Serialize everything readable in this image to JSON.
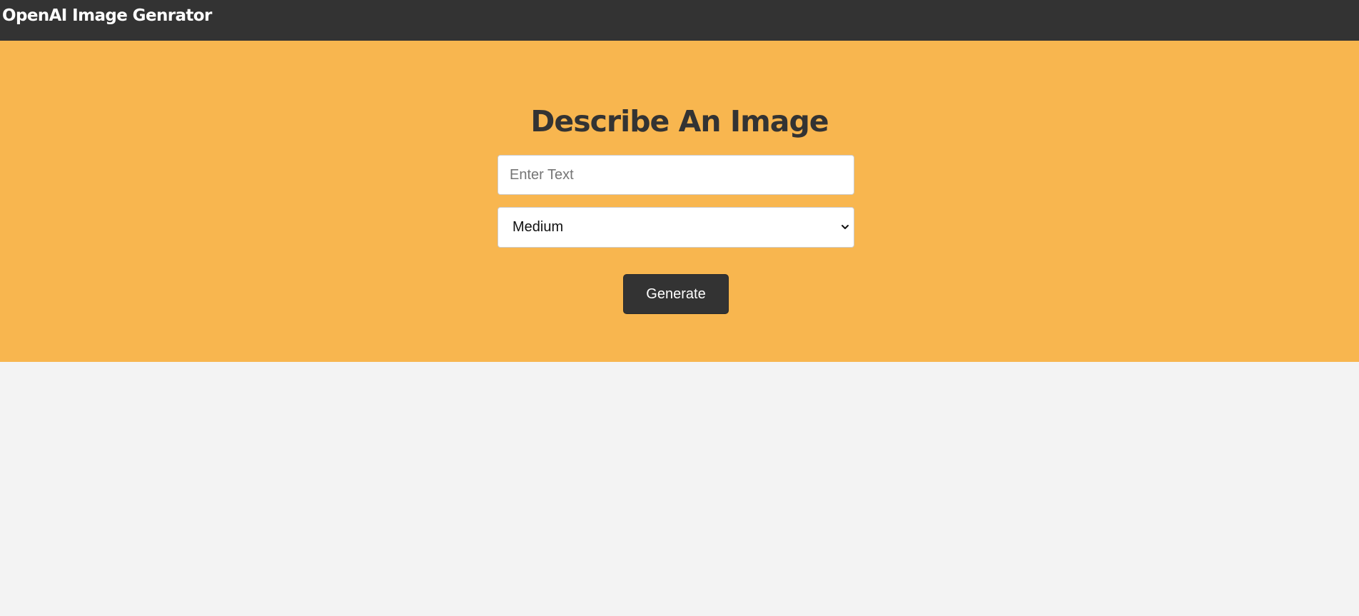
{
  "navbar": {
    "logo_text": "OpenAI Image Genrator"
  },
  "showcase": {
    "heading": "Describe An Image",
    "prompt_input": {
      "value": "",
      "placeholder": "Enter Text"
    },
    "size_select": {
      "selected": "Medium",
      "icon": "chevron-down-icon"
    },
    "generate_label": "Generate"
  },
  "colors": {
    "navbar_bg": "#333333",
    "accent": "#f8b64f",
    "page_bg": "#f3f3f3",
    "button_bg": "#333333",
    "heading_text": "#333333"
  }
}
